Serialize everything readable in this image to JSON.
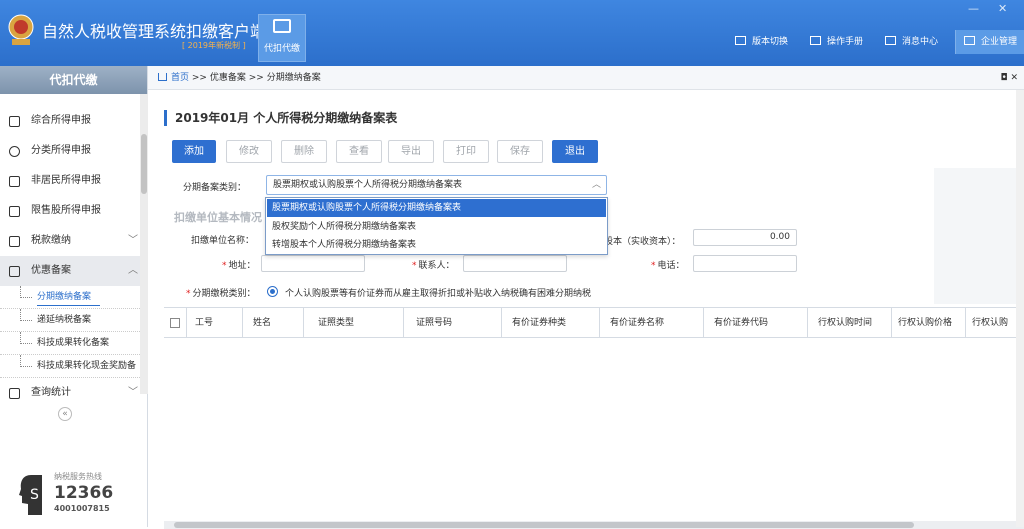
{
  "app": {
    "title": "自然人税收管理系统扣缴客户端",
    "edition": "[ 2019年新税制 ]",
    "module_label": "代扣代缴"
  },
  "window_controls": [
    "—",
    "✕"
  ],
  "top_nav": [
    {
      "label": "版本切换",
      "icon": "switch-icon"
    },
    {
      "label": "操作手册",
      "icon": "book-icon"
    },
    {
      "label": "消息中心",
      "icon": "mail-icon"
    },
    {
      "label": "企业管理",
      "icon": "building-icon"
    }
  ],
  "sidebar": {
    "header": "代扣代缴",
    "items": [
      {
        "label": "综合所得申报",
        "icon": "layers-icon"
      },
      {
        "label": "分类所得申报",
        "icon": "pie-icon"
      },
      {
        "label": "非居民所得申报",
        "icon": "person-icon"
      },
      {
        "label": "限售股所得申报",
        "icon": "bar-chart-icon"
      },
      {
        "label": "税款缴纳",
        "icon": "wallet-icon"
      },
      {
        "label": "优惠备案",
        "icon": "document-icon"
      },
      {
        "label": "查询统计",
        "icon": "list-icon"
      }
    ],
    "subitems": [
      "分期缴纳备案",
      "递延纳税备案",
      "科技成果转化备案",
      "科技成果转化现金奖励备"
    ],
    "collapse": "«",
    "hotline": {
      "label": "纳税服务热线",
      "number": "12366",
      "sub": "4001007815"
    }
  },
  "breadcrumb": {
    "home": "首页",
    "sep1": ">>",
    "b1": "优惠备案",
    "sep2": ">>",
    "b2": "分期缴纳备案",
    "controls": "◘ ✕"
  },
  "page": {
    "title": "2019年01月  个人所得税分期缴纳备案表"
  },
  "toolbar": {
    "add": "添加",
    "edit": "修改",
    "delete": "删除",
    "view": "查看",
    "export": "导出",
    "print": "打印",
    "save": "保存",
    "exit": "退出"
  },
  "form": {
    "type_label": "分期备案类别：",
    "type_value": "股票期权或认购股票个人所得税分期缴纳备案表",
    "section_title": "扣缴单位基本情况",
    "unit_name_label": "扣缴单位名称：",
    "capital_label": "股本（实收资本）：",
    "capital_value": "0.00",
    "address_label": "地址：",
    "contact_label": "联系人：",
    "phone_label": "电话：",
    "reason_label": "分期缴税类别：",
    "reason_value": "个人认购股票等有价证券而从雇主取得折扣或补贴收入纳税确有困难分期纳税"
  },
  "dropdown": {
    "options": [
      "股票期权或认购股票个人所得税分期缴纳备案表",
      "股权奖励个人所得税分期缴纳备案表",
      "转增股本个人所得税分期缴纳备案表"
    ]
  },
  "table": {
    "headers": [
      "工号",
      "姓名",
      "证照类型",
      "证照号码",
      "有价证券种类",
      "有价证券名称",
      "有价证券代码",
      "行权认购时间",
      "行权认购价格",
      "行权认购"
    ]
  }
}
